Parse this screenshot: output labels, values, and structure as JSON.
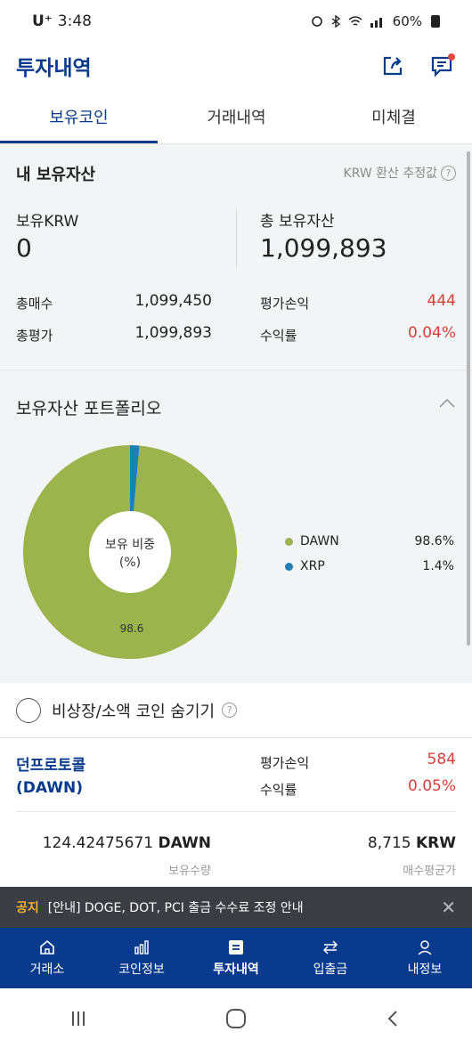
{
  "statusbar": {
    "carrier": "U⁺",
    "time": "3:48",
    "battery": "60%"
  },
  "header": {
    "title": "투자내역"
  },
  "tabs": [
    {
      "label": "보유코인",
      "active": true
    },
    {
      "label": "거래내역",
      "active": false
    },
    {
      "label": "미체결",
      "active": false
    }
  ],
  "summary": {
    "title": "내 보유자산",
    "note": "KRW 환산 추정값",
    "krw_label": "보유KRW",
    "krw_value": "0",
    "total_label": "총 보유자산",
    "total_value": "1,099,893",
    "buy_label": "총매수",
    "buy_value": "1,099,450",
    "eval_label": "총평가",
    "eval_value": "1,099,893",
    "pnl_label": "평가손익",
    "pnl_value": "444",
    "roi_label": "수익률",
    "roi_value": "0.04%"
  },
  "portfolio": {
    "title": "보유자산 포트폴리오",
    "center_label_1": "보유 비중",
    "center_label_2": "(%)",
    "slice_label": "98.6"
  },
  "chart_data": {
    "type": "pie",
    "categories": [
      "DAWN",
      "XRP"
    ],
    "values": [
      98.6,
      1.4
    ],
    "colors": [
      "#9cb44c",
      "#1f7fb8"
    ],
    "legend": [
      {
        "name": "DAWN",
        "pct": "98.6%"
      },
      {
        "name": "XRP",
        "pct": "1.4%"
      }
    ],
    "title": "",
    "center_text": "보유 비중 (%)"
  },
  "hide_toggle": {
    "label": "비상장/소액 코인 숨기기"
  },
  "coin": {
    "name_kr": "던프로토콜",
    "symbol": "(DAWN)",
    "pnl_label": "평가손익",
    "pnl_value": "584",
    "roi_label": "수익률",
    "roi_value": "0.05%",
    "qty_value": "124.42475671",
    "qty_unit": "DAWN",
    "qty_label": "보유수량",
    "avg_value": "8,715",
    "avg_unit": "KRW",
    "avg_label": "매수평균가"
  },
  "notice": {
    "tag": "공지",
    "text": "[안내] DOGE, DOT, PCI 출금 수수료 조정 안내"
  },
  "bottomnav": [
    {
      "label": "거래소",
      "icon": "home-icon"
    },
    {
      "label": "코인정보",
      "icon": "chart-icon"
    },
    {
      "label": "투자내역",
      "icon": "list-icon",
      "active": true
    },
    {
      "label": "입출금",
      "icon": "transfer-icon"
    },
    {
      "label": "내정보",
      "icon": "user-icon"
    }
  ],
  "colors": {
    "brand": "#0a3a8c",
    "positive": "#d6403a",
    "dawn": "#9cb44c",
    "xrp": "#1f7fb8"
  }
}
